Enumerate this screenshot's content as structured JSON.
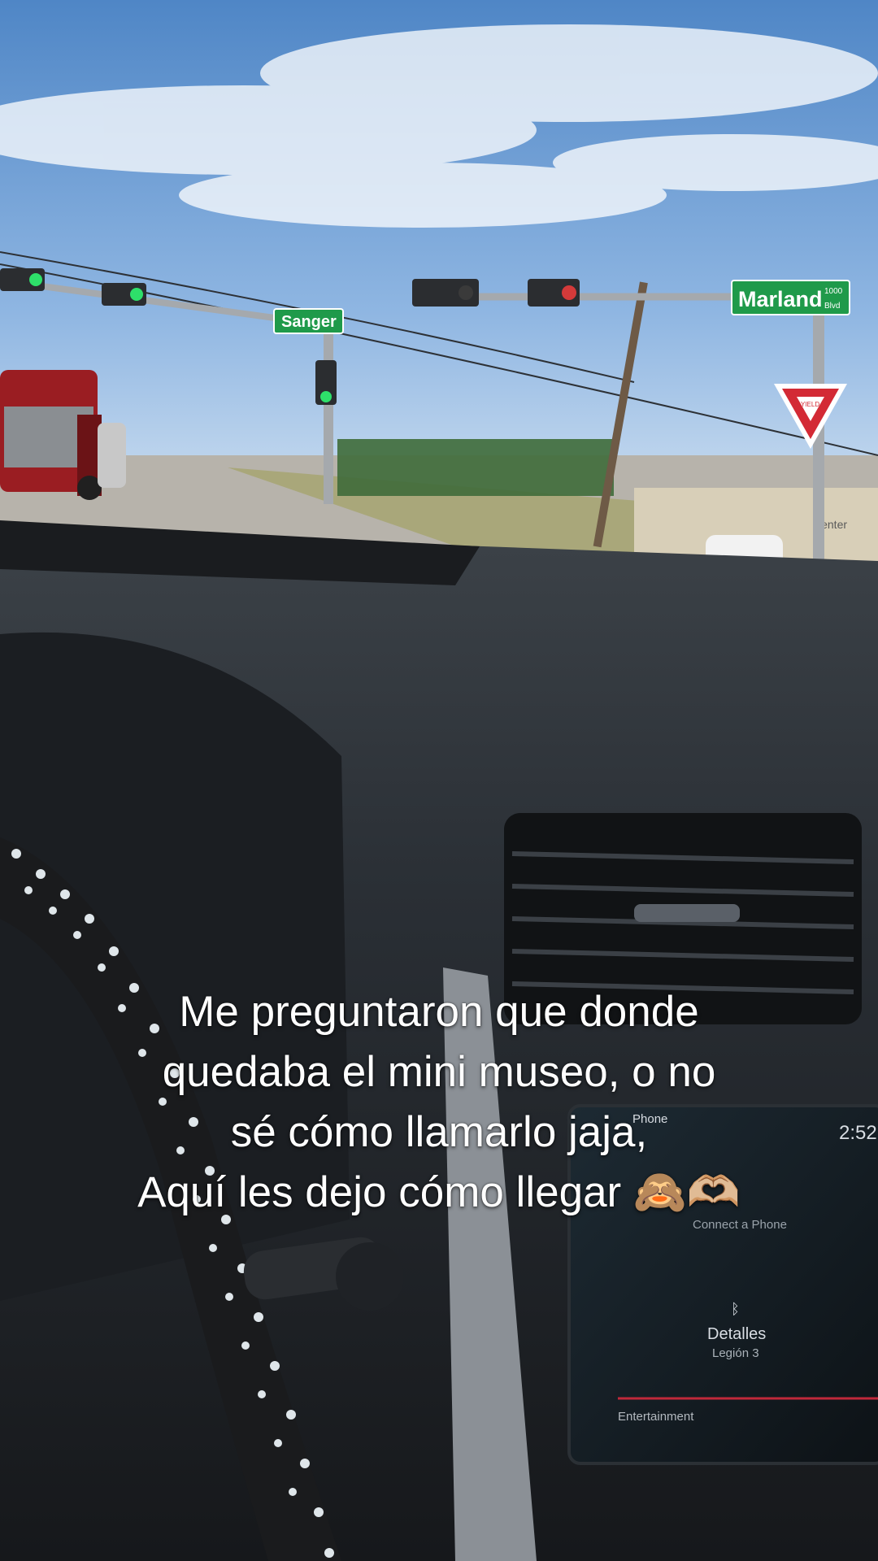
{
  "scene": {
    "street_signs": {
      "left": "Sanger",
      "right": "Marland",
      "right_number": "1000",
      "right_suffix": "Blvd"
    },
    "yield_sign": "YIELD",
    "building_sign": "Center"
  },
  "radio": {
    "clock": "2:52",
    "label_phone": "Phone",
    "connect": "Connect a Phone",
    "detail": "Detalles",
    "device": "Legión 3",
    "entertainment": "Entertainment"
  },
  "caption": {
    "line1": "Me preguntaron que donde",
    "line2": "quedaba el mini museo, o no",
    "line3": "sé cómo llamarlo jaja,",
    "line4": "Aquí les dejo cómo llegar 🙈🫶🏼"
  },
  "colors": {
    "sky": "#6f9fd6",
    "sign_green": "#1f9a4a",
    "dash": "#25292e"
  }
}
